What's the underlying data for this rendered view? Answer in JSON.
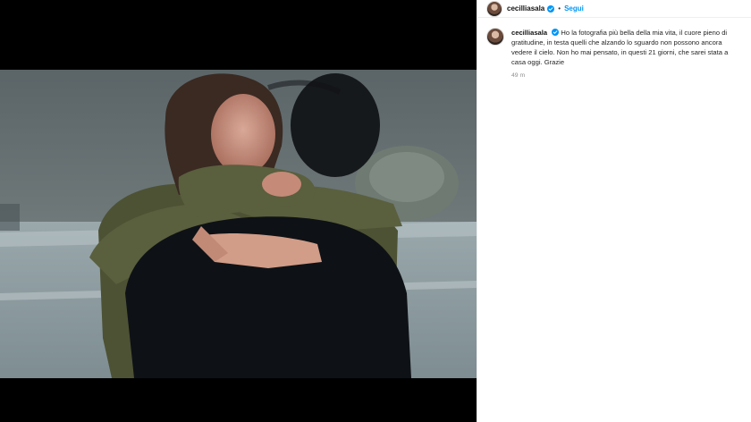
{
  "post": {
    "username": "cecilliasala",
    "follow_label": "Segui",
    "separator": "•",
    "caption": "Ho la fotografia più bella della mia vita, il cuore pieno di gratitudine, in testa quelli che alzando lo sguardo non possono ancora vedere il cielo. Non ho mai pensato, in questi 21 giorni, che sarei stata a casa oggi. Grazie",
    "time_ago": "49 m"
  },
  "icons": {
    "verified": "verified-badge-icon",
    "avatar": "profile-avatar"
  },
  "colors": {
    "follow": "#0095f6",
    "verified": "#0095f6",
    "muted": "#8e8e8e"
  }
}
